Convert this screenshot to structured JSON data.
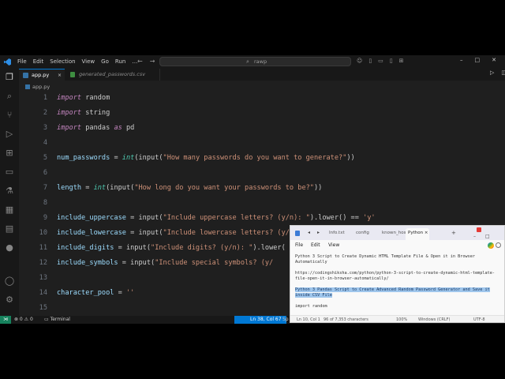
{
  "titlebar": {
    "menu": [
      "File",
      "Edit",
      "Selection",
      "View",
      "Go",
      "Run",
      "…"
    ],
    "search_text": "rawp",
    "window_controls": [
      "–",
      "□",
      "✕"
    ]
  },
  "tabs": {
    "active": "app.py",
    "inactive": "generated_passwords.csv",
    "close": "×"
  },
  "breadcrumb": "app.py",
  "code": [
    {
      "n": "1",
      "tokens": [
        [
          "kw",
          "import"
        ],
        [
          "t",
          " random"
        ]
      ]
    },
    {
      "n": "2",
      "tokens": [
        [
          "kw",
          "import"
        ],
        [
          "t",
          " string"
        ]
      ]
    },
    {
      "n": "3",
      "tokens": [
        [
          "kw",
          "import"
        ],
        [
          "t",
          " pandas "
        ],
        [
          "kw",
          "as"
        ],
        [
          "t",
          " pd"
        ]
      ]
    },
    {
      "n": "4",
      "tokens": []
    },
    {
      "n": "5",
      "tokens": [
        [
          "vr",
          "num_passwords"
        ],
        [
          "t",
          " = "
        ],
        [
          "fn",
          "int"
        ],
        [
          "t",
          "(input("
        ],
        [
          "st",
          "\"How many passwords do you want to generate?\""
        ],
        [
          "t",
          "))"
        ]
      ]
    },
    {
      "n": "6",
      "tokens": []
    },
    {
      "n": "7",
      "tokens": [
        [
          "vr",
          "length"
        ],
        [
          "t",
          " = "
        ],
        [
          "fn",
          "int"
        ],
        [
          "t",
          "(input("
        ],
        [
          "st",
          "\"How long do you want your passwords to be?\""
        ],
        [
          "t",
          "))"
        ]
      ]
    },
    {
      "n": "8",
      "tokens": []
    },
    {
      "n": "9",
      "tokens": [
        [
          "vr",
          "include_uppercase"
        ],
        [
          "t",
          " = input("
        ],
        [
          "st",
          "\"Include uppercase letters? (y/n): \""
        ],
        [
          "t",
          ").lower() == "
        ],
        [
          "st",
          "'y'"
        ]
      ]
    },
    {
      "n": "10",
      "tokens": [
        [
          "vr",
          "include_lowercase"
        ],
        [
          "t",
          " = input("
        ],
        [
          "st",
          "\"Include lowercase letters? (y/"
        ]
      ]
    },
    {
      "n": "11",
      "tokens": [
        [
          "vr",
          "include_digits"
        ],
        [
          "t",
          " = input("
        ],
        [
          "st",
          "\"Include digits? (y/n): \""
        ],
        [
          "t",
          ").lower("
        ]
      ]
    },
    {
      "n": "12",
      "tokens": [
        [
          "vr",
          "include_symbols"
        ],
        [
          "t",
          " = input("
        ],
        [
          "st",
          "\"Include special symbols? (y/"
        ]
      ]
    },
    {
      "n": "13",
      "tokens": []
    },
    {
      "n": "14",
      "tokens": [
        [
          "vr",
          "character_pool"
        ],
        [
          "t",
          " = "
        ],
        [
          "st",
          "''"
        ]
      ]
    },
    {
      "n": "15",
      "tokens": []
    }
  ],
  "statusbar": {
    "remote": "⋊",
    "problems": "⊗ 0 ⚠ 0",
    "terminal": "Terminal",
    "position": "Ln 38, Col 67",
    "more": "Sp"
  },
  "notepad": {
    "tabs": [
      "Info.txt",
      "config",
      "known_host"
    ],
    "active_tab": "Python",
    "menu": [
      "File",
      "Edit",
      "View"
    ],
    "lines": [
      "Python 3 Script to Create Dynamic HTML Template File & Open it in Browser",
      "Automatically",
      "",
      "https://codingshiksha.com/python/python-3-script-to-create-dynamic-html-template-",
      "file-open-it-in-browser-automatically/",
      "",
      "HL:Python 3 Pandas Script to Create Advanced Random Password Generator and Save it",
      "HL:inside CSV File",
      "",
      "import random"
    ],
    "status": {
      "position": "Ln 10, Col 1",
      "count": "96 of 7,353 characters",
      "zoom": "100%",
      "eol": "Windows (CRLF)",
      "encoding": "UTF-8"
    }
  },
  "colors": {
    "accent": "#0078d4",
    "keyword": "#c586c0",
    "function": "#4ec9b0",
    "string": "#ce9178",
    "variable": "#9cdcfe"
  }
}
